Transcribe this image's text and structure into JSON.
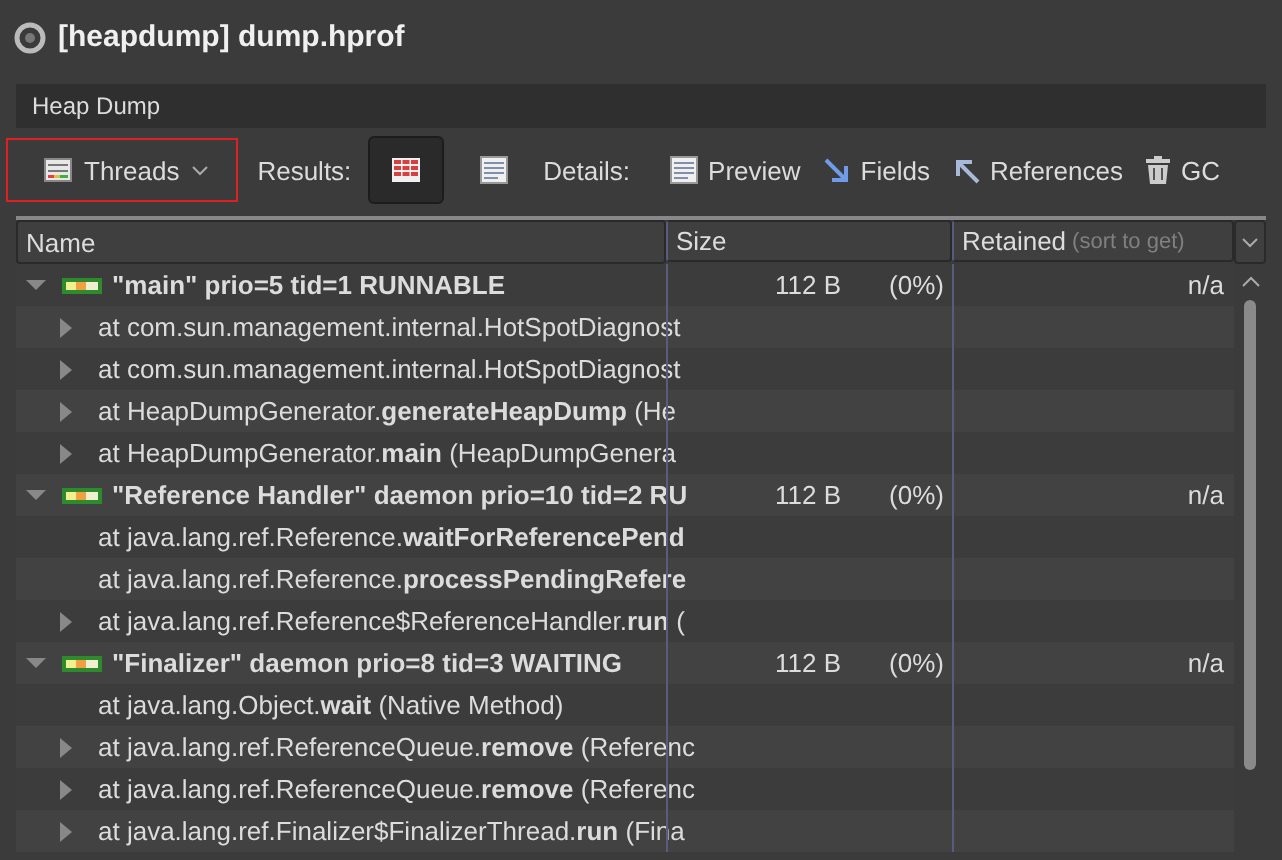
{
  "window": {
    "title": "[heapdump] dump.hprof"
  },
  "breadcrumb": "Heap Dump",
  "toolbar": {
    "view": {
      "label": "Threads",
      "highlighted": true
    },
    "results_label": "Results:",
    "results": [
      {
        "kind": "table",
        "selected": true
      },
      {
        "kind": "details",
        "selected": false
      }
    ],
    "details_label": "Details:",
    "details": [
      {
        "kind": "preview",
        "label": "Preview"
      },
      {
        "kind": "fields",
        "label": "Fields"
      },
      {
        "kind": "references",
        "label": "References"
      },
      {
        "kind": "gc",
        "label": "GC"
      }
    ]
  },
  "table": {
    "columns": [
      {
        "label": "Name"
      },
      {
        "label": "Size"
      },
      {
        "label": "Retained",
        "hint": "(sort to get)"
      }
    ],
    "rows": [
      {
        "text": "\"main\" prio=5 tid=1 RUNNABLE",
        "size": "112 B",
        "percent": "(0%)",
        "retained": "n/a",
        "expanded": true,
        "children": [
          {
            "text": "at com.sun.management.internal.HotSpotDiagnost",
            "expandable": true
          },
          {
            "text": "at com.sun.management.internal.HotSpotDiagnost",
            "expandable": true
          },
          {
            "text": "at HeapDumpGenerator.**generateHeapDump** (He",
            "expandable": true
          },
          {
            "text": "at HeapDumpGenerator.**main** (HeapDumpGenera",
            "expandable": true
          }
        ]
      },
      {
        "text": "\"Reference Handler\" daemon prio=10 tid=2 RU",
        "size": "112 B",
        "percent": "(0%)",
        "retained": "n/a",
        "expanded": true,
        "children": [
          {
            "text": "at java.lang.ref.Reference.**waitForReferencePend**",
            "expandable": false
          },
          {
            "text": "at java.lang.ref.Reference.**processPendingRefere**",
            "expandable": false
          },
          {
            "text": "at java.lang.ref.Reference$ReferenceHandler.**run** (",
            "expandable": true
          }
        ]
      },
      {
        "text": "\"Finalizer\" daemon prio=8 tid=3 WAITING",
        "size": "112 B",
        "percent": "(0%)",
        "retained": "n/a",
        "expanded": true,
        "children": [
          {
            "text": "at java.lang.Object.**wait** (Native Method)",
            "expandable": false
          },
          {
            "text": "at java.lang.ref.ReferenceQueue.**remove** (Referenc",
            "expandable": true
          },
          {
            "text": "at java.lang.ref.ReferenceQueue.**remove** (Referenc",
            "expandable": true
          },
          {
            "text": "at java.lang.ref.Finalizer$FinalizerThread.**run** (Fina",
            "expandable": true
          }
        ]
      }
    ]
  }
}
